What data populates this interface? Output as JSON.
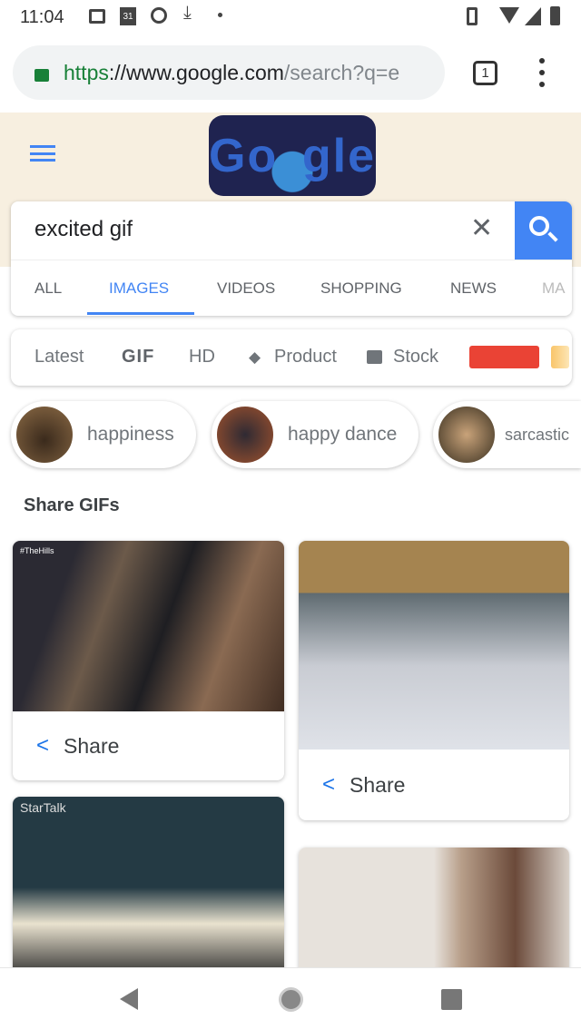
{
  "status": {
    "time": "11:04",
    "calendar_day": "31"
  },
  "browser": {
    "url_scheme": "https",
    "url_host": "://www.google.com",
    "url_path": "/search?q=e",
    "tab_count": "1"
  },
  "search": {
    "query": "excited gif",
    "tabs": [
      {
        "label": "ALL"
      },
      {
        "label": "IMAGES",
        "active": true
      },
      {
        "label": "VIDEOS"
      },
      {
        "label": "SHOPPING"
      },
      {
        "label": "NEWS"
      },
      {
        "label": "MA"
      }
    ]
  },
  "filters": [
    {
      "label": "Latest"
    },
    {
      "label": "GIF"
    },
    {
      "label": "HD"
    },
    {
      "label": "Product",
      "icon": "tag-icon"
    },
    {
      "label": "Stock",
      "icon": "image-icon"
    }
  ],
  "color_filters": [
    "#ea4335",
    "#f9c56a"
  ],
  "related": [
    {
      "label": "happiness"
    },
    {
      "label": "happy dance"
    },
    {
      "label": "sarcastic"
    }
  ],
  "section_title": "Share GIFs",
  "results": [
    {
      "share_label": "Share",
      "watermark": "#TheHills"
    },
    {
      "share_label": "Share"
    },
    {
      "watermark": "StarTalk"
    },
    {}
  ],
  "colors": {
    "accent": "#1a73e8",
    "search_button": "#4285f4",
    "lock": "#188038"
  }
}
